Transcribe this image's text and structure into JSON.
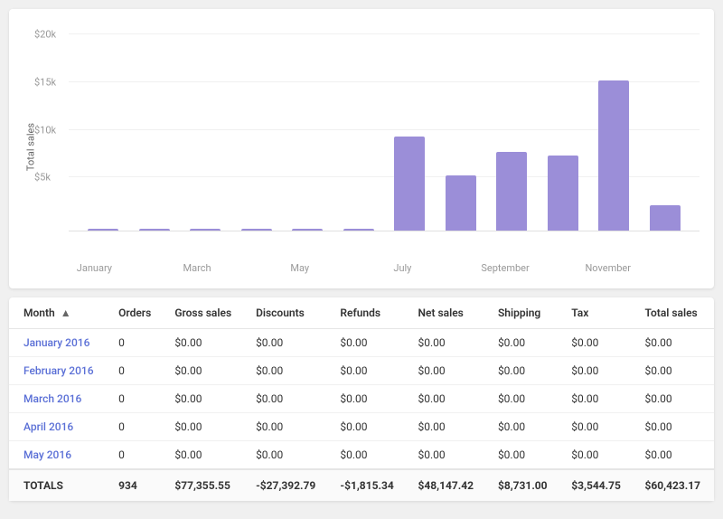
{
  "chart": {
    "y_axis_label": "Total sales",
    "y_ticks": [
      "$20k",
      "$15k",
      "$10k",
      "$5k"
    ],
    "x_labels": [
      "January",
      "March",
      "May",
      "July",
      "September",
      "November",
      ""
    ],
    "bars": [
      {
        "month": "January",
        "height_pct": 1
      },
      {
        "month": "February",
        "height_pct": 1
      },
      {
        "month": "March",
        "height_pct": 1
      },
      {
        "month": "April",
        "height_pct": 1
      },
      {
        "month": "May",
        "height_pct": 1
      },
      {
        "month": "June",
        "height_pct": 1
      },
      {
        "month": "July",
        "height_pct": 56
      },
      {
        "month": "August",
        "height_pct": 33
      },
      {
        "month": "September",
        "height_pct": 47
      },
      {
        "month": "October",
        "height_pct": 45
      },
      {
        "month": "November",
        "height_pct": 90
      },
      {
        "month": "December",
        "height_pct": 15
      }
    ]
  },
  "table": {
    "headers": {
      "month": "Month",
      "orders": "Orders",
      "gross_sales": "Gross sales",
      "discounts": "Discounts",
      "refunds": "Refunds",
      "net_sales": "Net sales",
      "shipping": "Shipping",
      "tax": "Tax",
      "total_sales": "Total sales"
    },
    "rows": [
      {
        "month": "January 2016",
        "orders": "0",
        "gross_sales": "$0.00",
        "discounts": "$0.00",
        "refunds": "$0.00",
        "net_sales": "$0.00",
        "shipping": "$0.00",
        "tax": "$0.00",
        "total_sales": "$0.00"
      },
      {
        "month": "February 2016",
        "orders": "0",
        "gross_sales": "$0.00",
        "discounts": "$0.00",
        "refunds": "$0.00",
        "net_sales": "$0.00",
        "shipping": "$0.00",
        "tax": "$0.00",
        "total_sales": "$0.00"
      },
      {
        "month": "March 2016",
        "orders": "0",
        "gross_sales": "$0.00",
        "discounts": "$0.00",
        "refunds": "$0.00",
        "net_sales": "$0.00",
        "shipping": "$0.00",
        "tax": "$0.00",
        "total_sales": "$0.00"
      },
      {
        "month": "April 2016",
        "orders": "0",
        "gross_sales": "$0.00",
        "discounts": "$0.00",
        "refunds": "$0.00",
        "net_sales": "$0.00",
        "shipping": "$0.00",
        "tax": "$0.00",
        "total_sales": "$0.00"
      },
      {
        "month": "May 2016",
        "orders": "0",
        "gross_sales": "$0.00",
        "discounts": "$0.00",
        "refunds": "$0.00",
        "net_sales": "$0.00",
        "shipping": "$0.00",
        "tax": "$0.00",
        "total_sales": "$0.00"
      }
    ],
    "totals": {
      "label": "TOTALS",
      "orders": "934",
      "gross_sales": "$77,355.55",
      "discounts": "-$27,392.79",
      "refunds": "-$1,815.34",
      "net_sales": "$48,147.42",
      "shipping": "$8,731.00",
      "tax": "$3,544.75",
      "total_sales": "$60,423.17"
    }
  }
}
